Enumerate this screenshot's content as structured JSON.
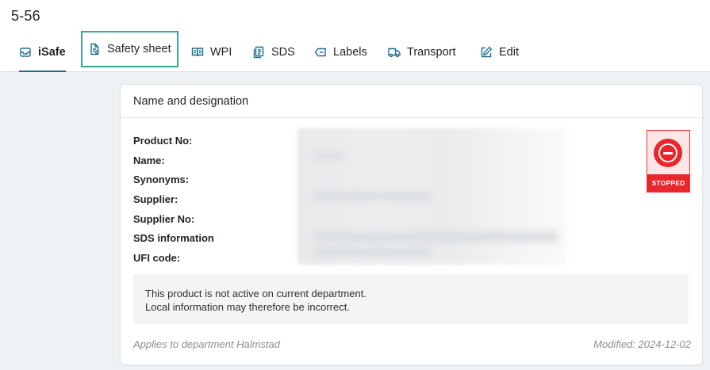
{
  "page": {
    "title": "5-56"
  },
  "tabs": [
    {
      "label": "iSafe",
      "icon": "box-icon",
      "active": true
    },
    {
      "label": "Safety sheet",
      "icon": "document-icon",
      "highlighted": true
    },
    {
      "label": "WPI",
      "icon": "book-icon"
    },
    {
      "label": "SDS",
      "icon": "files-icon"
    },
    {
      "label": "Labels",
      "icon": "label-icon"
    },
    {
      "label": "Transport",
      "icon": "truck-icon"
    },
    {
      "label": "Edit",
      "icon": "edit-icon"
    }
  ],
  "card": {
    "title": "Name and designation",
    "fields": [
      {
        "label": "Product No:"
      },
      {
        "label": "Name:"
      },
      {
        "label": "Synonyms:"
      },
      {
        "label": "Supplier:"
      },
      {
        "label": "Supplier No:"
      },
      {
        "label": "SDS information"
      },
      {
        "label": "UFI code:"
      }
    ],
    "status_badge": {
      "label": "STOPPED",
      "color": "#e8262b"
    },
    "notice": {
      "line1": "This product is not active on current department.",
      "line2": "Local information may therefore be incorrect."
    },
    "footer": {
      "applies_to": "Applies to department Halmstad",
      "modified": "Modified: 2024-12-02"
    }
  },
  "colors": {
    "accent": "#1e6b8f",
    "highlight_outline": "#3aa899",
    "background": "#eef2f5"
  }
}
